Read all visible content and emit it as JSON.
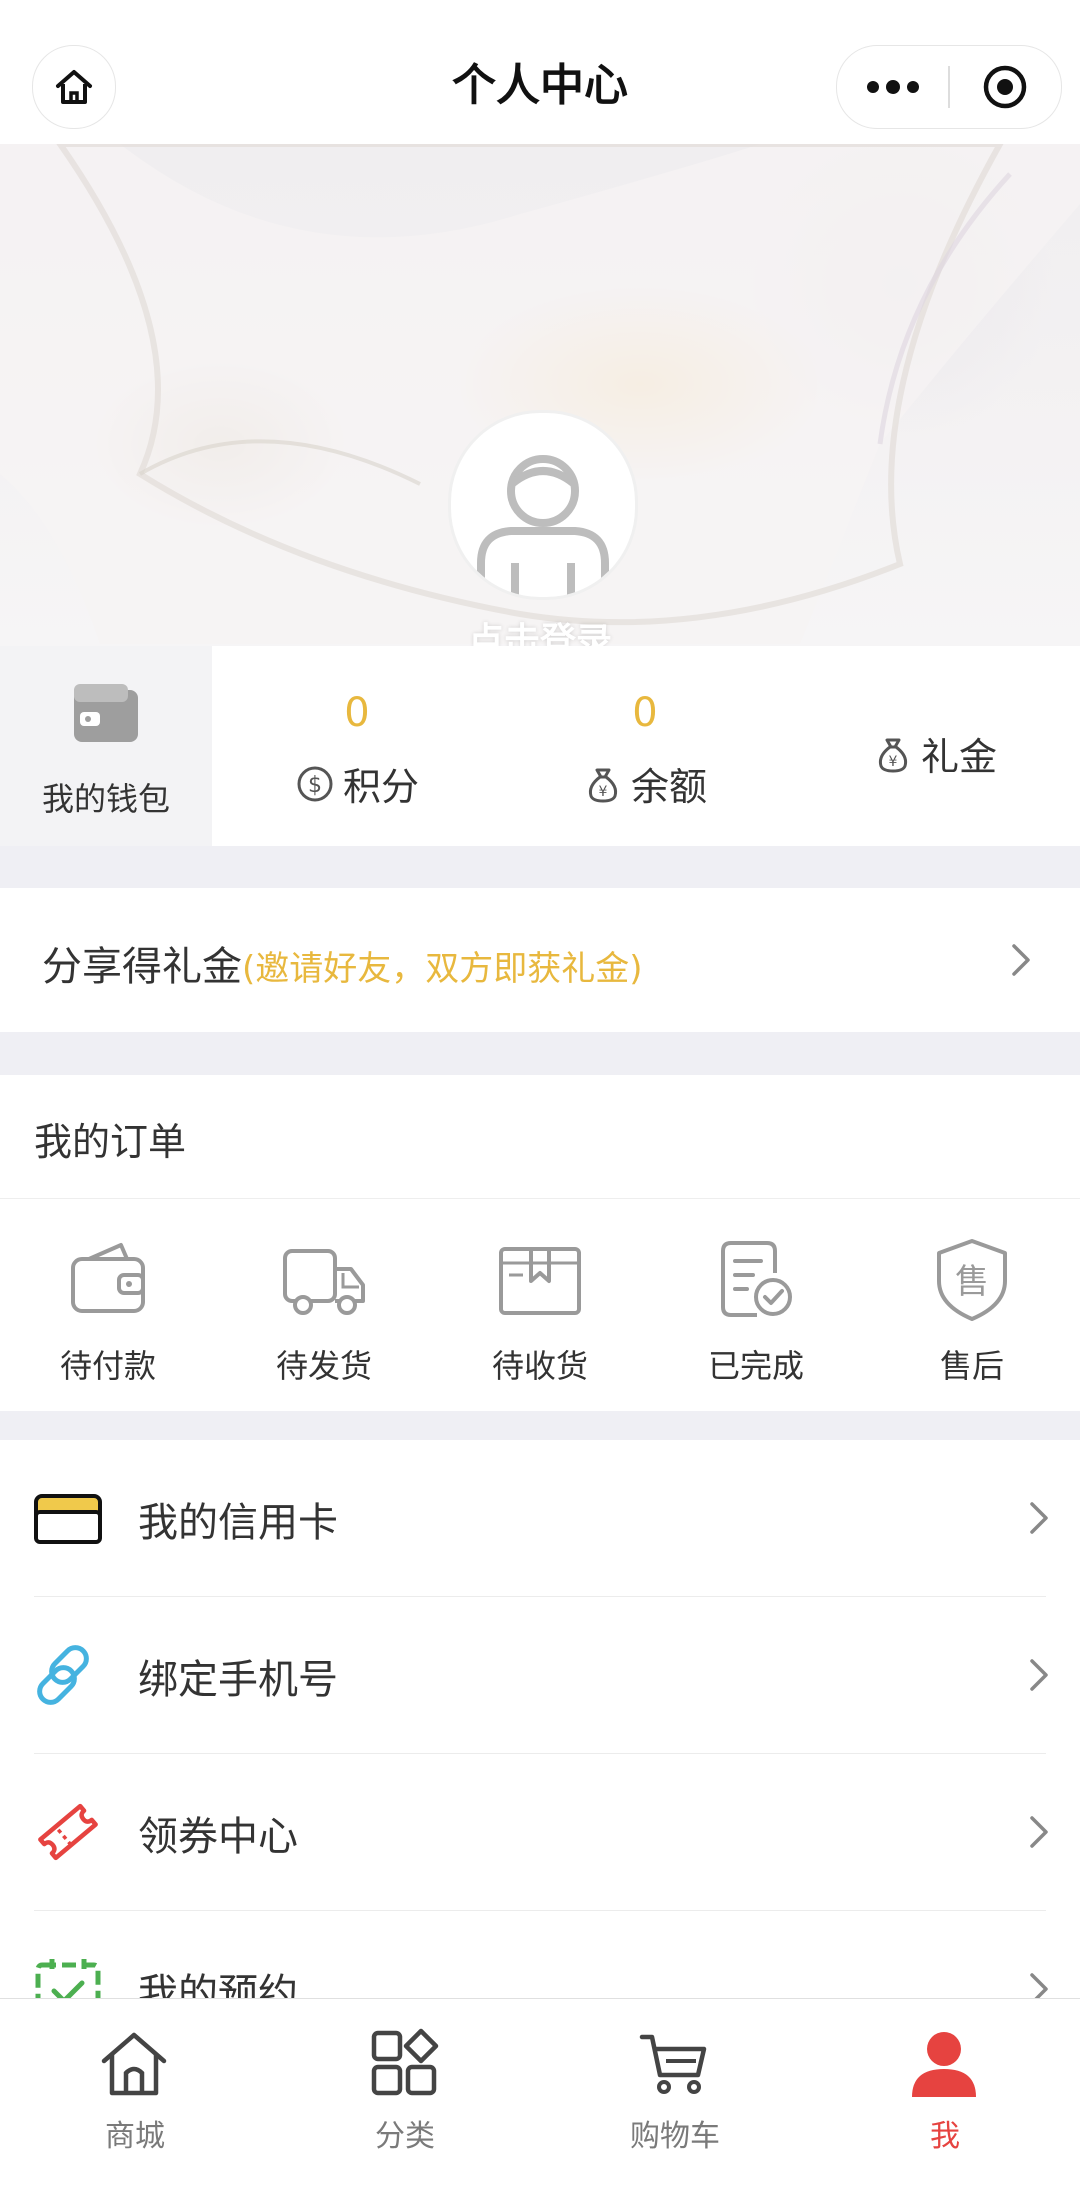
{
  "nav": {
    "title": "个人中心"
  },
  "hero": {
    "login_text": "点击登录"
  },
  "assets": {
    "wallet_label": "我的钱包",
    "points": {
      "value": "0",
      "label": "积分"
    },
    "balance": {
      "value": "0",
      "label": "余额"
    },
    "gift": {
      "label": "礼金"
    },
    "accent": "#e8b83e"
  },
  "share": {
    "title": "分享得礼金",
    "subtitle": "(邀请好友，双方即获礼金)"
  },
  "orders": {
    "title": "我的订单",
    "items": [
      {
        "label": "待付款",
        "icon": "wallet-icon"
      },
      {
        "label": "待发货",
        "icon": "truck-icon"
      },
      {
        "label": "待收货",
        "icon": "box-icon"
      },
      {
        "label": "已完成",
        "icon": "document-check-icon"
      },
      {
        "label": "售后",
        "icon": "shield-icon"
      }
    ]
  },
  "menu": [
    {
      "label": "我的信用卡",
      "icon": "credit-card-icon",
      "color": "#f0c94b"
    },
    {
      "label": "绑定手机号",
      "icon": "link-icon",
      "color": "#45b3e0"
    },
    {
      "label": "领券中心",
      "icon": "ticket-icon",
      "color": "#e64340"
    },
    {
      "label": "我的预约",
      "icon": "calendar-check-icon",
      "color": "#4caf50"
    }
  ],
  "tabbar": {
    "items": [
      {
        "label": "商城",
        "icon": "home-icon"
      },
      {
        "label": "分类",
        "icon": "grid-icon"
      },
      {
        "label": "购物车",
        "icon": "cart-icon"
      },
      {
        "label": "我",
        "icon": "user-icon",
        "active": true
      }
    ],
    "active_color": "#e64340"
  }
}
